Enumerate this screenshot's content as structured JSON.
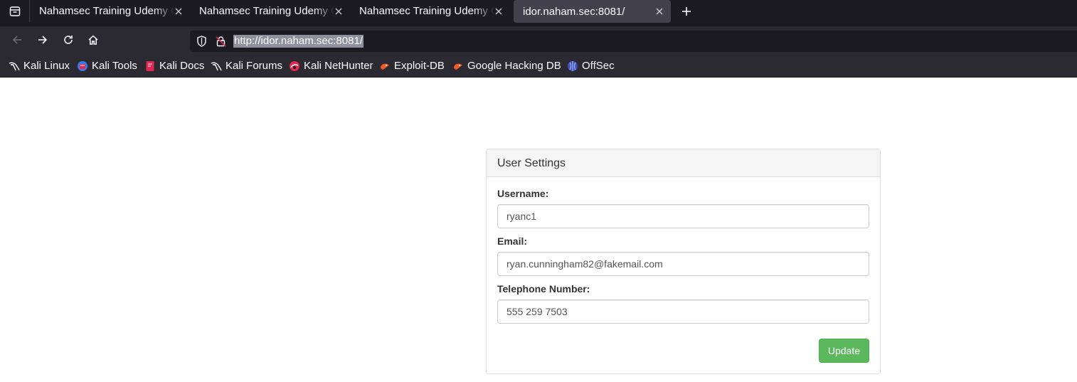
{
  "browser": {
    "tabs": [
      {
        "title": "Nahamsec Training Udemy Course",
        "active": false
      },
      {
        "title": "Nahamsec Training Udemy Course",
        "active": false
      },
      {
        "title": "Nahamsec Training Udemy Course",
        "active": false
      },
      {
        "title": "idor.naham.sec:8081/",
        "active": true
      }
    ],
    "url": "http://idor.naham.sec:8081/",
    "bookmarks": [
      {
        "label": "Kali Linux",
        "icon": "kali-dragon-icon"
      },
      {
        "label": "Kali Tools",
        "icon": "kali-tools-icon"
      },
      {
        "label": "Kali Docs",
        "icon": "kali-docs-icon"
      },
      {
        "label": "Kali Forums",
        "icon": "kali-dragon-icon"
      },
      {
        "label": "Kali NetHunter",
        "icon": "nethunter-icon"
      },
      {
        "label": "Exploit-DB",
        "icon": "exploit-db-icon"
      },
      {
        "label": "Google Hacking DB",
        "icon": "exploit-db-icon"
      },
      {
        "label": "OffSec",
        "icon": "offsec-icon"
      }
    ]
  },
  "settings": {
    "heading": "User Settings",
    "username_label": "Username:",
    "username_value": "ryanc1",
    "email_label": "Email:",
    "email_value": "ryan.cunningham82@fakemail.com",
    "phone_label": "Telephone Number:",
    "phone_value": "555 259 7503",
    "update_label": "Update"
  },
  "colors": {
    "tabstrip": "#1c1b22",
    "toolbar": "#2b2a33",
    "active_tab": "#42414d",
    "update_button": "#5cb85c"
  }
}
